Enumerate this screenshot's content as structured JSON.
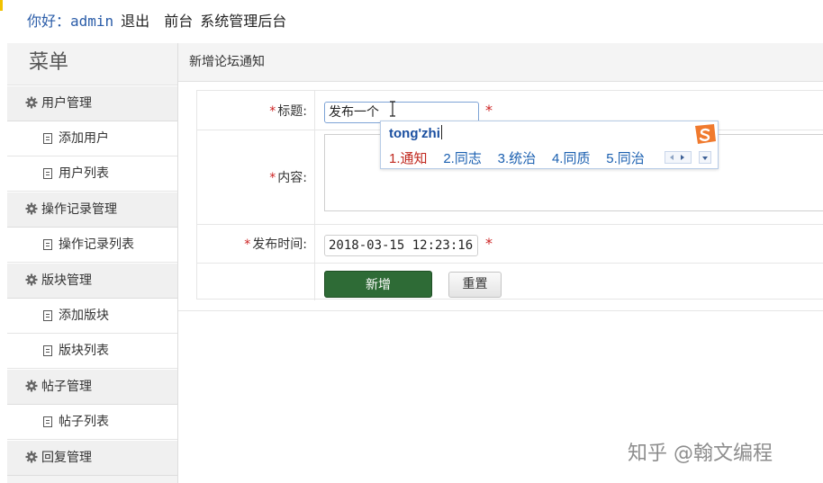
{
  "header": {
    "greeting": "你好：admin",
    "logout": "退出",
    "frontend": "前台",
    "system_title": "系统管理后台"
  },
  "sidebar": {
    "title": "菜单",
    "groups": [
      {
        "label": "用户管理",
        "items": [
          {
            "label": "添加用户"
          },
          {
            "label": "用户列表"
          }
        ]
      },
      {
        "label": "操作记录管理",
        "items": [
          {
            "label": "操作记录列表"
          }
        ]
      },
      {
        "label": "版块管理",
        "items": [
          {
            "label": "添加版块"
          },
          {
            "label": "版块列表"
          }
        ]
      },
      {
        "label": "帖子管理",
        "items": [
          {
            "label": "帖子列表"
          }
        ]
      },
      {
        "label": "回复管理",
        "items": []
      }
    ]
  },
  "main": {
    "page_title": "新增论坛通知",
    "form": {
      "title_label": "标题:",
      "title_value": "发布一个",
      "content_label": "内容:",
      "time_label": "发布时间:",
      "time_value": "2018-03-15 12:23:16",
      "required_mark": "*",
      "submit_label": "新增",
      "reset_label": "重置"
    }
  },
  "ime": {
    "pinyin": "tong'zhi",
    "candidates": [
      {
        "num": "1.",
        "text": "通知"
      },
      {
        "num": "2.",
        "text": "同志"
      },
      {
        "num": "3.",
        "text": "统治"
      },
      {
        "num": "4.",
        "text": "同质"
      },
      {
        "num": "5.",
        "text": "同治"
      }
    ],
    "accent_color": "#c0281e",
    "logo_color": "#f07a2e"
  },
  "watermark": "知乎 @翰文编程",
  "colors": {
    "primary_button": "#2e6b36",
    "required": "#cc2222",
    "link_blue": "#2a5ca8"
  }
}
